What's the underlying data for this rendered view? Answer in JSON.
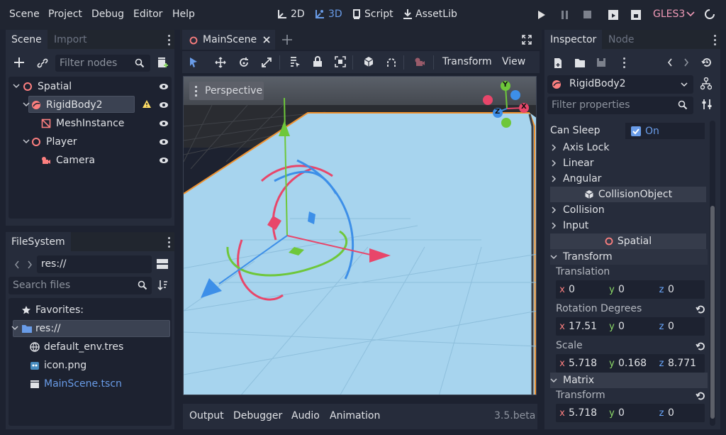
{
  "menu": {
    "items": [
      "Scene",
      "Project",
      "Debug",
      "Editor",
      "Help"
    ]
  },
  "workspaces": {
    "d2": "2D",
    "d3": "3D",
    "script": "Script",
    "assetlib": "AssetLib"
  },
  "renderer": {
    "label": "GLES3"
  },
  "scene_dock": {
    "tabs": [
      "Scene",
      "Import"
    ],
    "filter_placeholder": "Filter nodes",
    "nodes": [
      {
        "name": "Spatial"
      },
      {
        "name": "RigidBody2"
      },
      {
        "name": "MeshInstance"
      },
      {
        "name": "Player"
      },
      {
        "name": "Camera"
      }
    ]
  },
  "fs_dock": {
    "title": "FileSystem",
    "path": "res://",
    "search_placeholder": "Search files",
    "items": [
      {
        "name": "Favorites:"
      },
      {
        "name": "res://"
      },
      {
        "name": "default_env.tres"
      },
      {
        "name": "icon.png"
      },
      {
        "name": "MainScene.tscn"
      }
    ]
  },
  "viewport": {
    "tab_label": "MainScene",
    "perspective_label": "Perspective",
    "transform_menu": "Transform",
    "view_menu": "View",
    "gizmo": {
      "y": "Y",
      "x": "X",
      "z": "Z"
    }
  },
  "bottom": {
    "tabs": [
      "Output",
      "Debugger",
      "Audio",
      "Animation"
    ],
    "version": "3.5.beta"
  },
  "inspector": {
    "tabs": [
      "Inspector",
      "Node"
    ],
    "object_name": "RigidBody2",
    "filter_placeholder": "Filter properties",
    "can_sleep_label": "Can Sleep",
    "can_sleep_value": "On",
    "groups": {
      "axis_lock": "Axis Lock",
      "linear": "Linear",
      "angular": "Angular",
      "collision": "Collision",
      "input": "Input",
      "transform": "Transform",
      "matrix": "Matrix"
    },
    "sections": {
      "collision_object": "CollisionObject",
      "spatial": "Spatial"
    },
    "props": {
      "translation": "Translation",
      "rotation": "Rotation Degrees",
      "scale": "Scale",
      "matrix_transform": "Transform"
    },
    "values": {
      "translation": {
        "x": "0",
        "y": "0",
        "z": "0"
      },
      "rotation": {
        "x": "17.51",
        "y": "0",
        "z": "0"
      },
      "scale": {
        "x": "5.718",
        "y": "0.168",
        "z": "8.771"
      },
      "matrix": {
        "x": "5.718",
        "y": "0",
        "z": "0"
      }
    },
    "axis_letters": {
      "x": "x",
      "y": "y",
      "z": "z"
    }
  },
  "colors": {
    "accent": "#699ce8",
    "warning": "#ffdd65",
    "play": "#e0e0e0",
    "renderer": "#f09ab7",
    "axis_x": "#fc7f7f",
    "axis_y": "#8ddb68",
    "axis_z": "#6ba9ff"
  }
}
